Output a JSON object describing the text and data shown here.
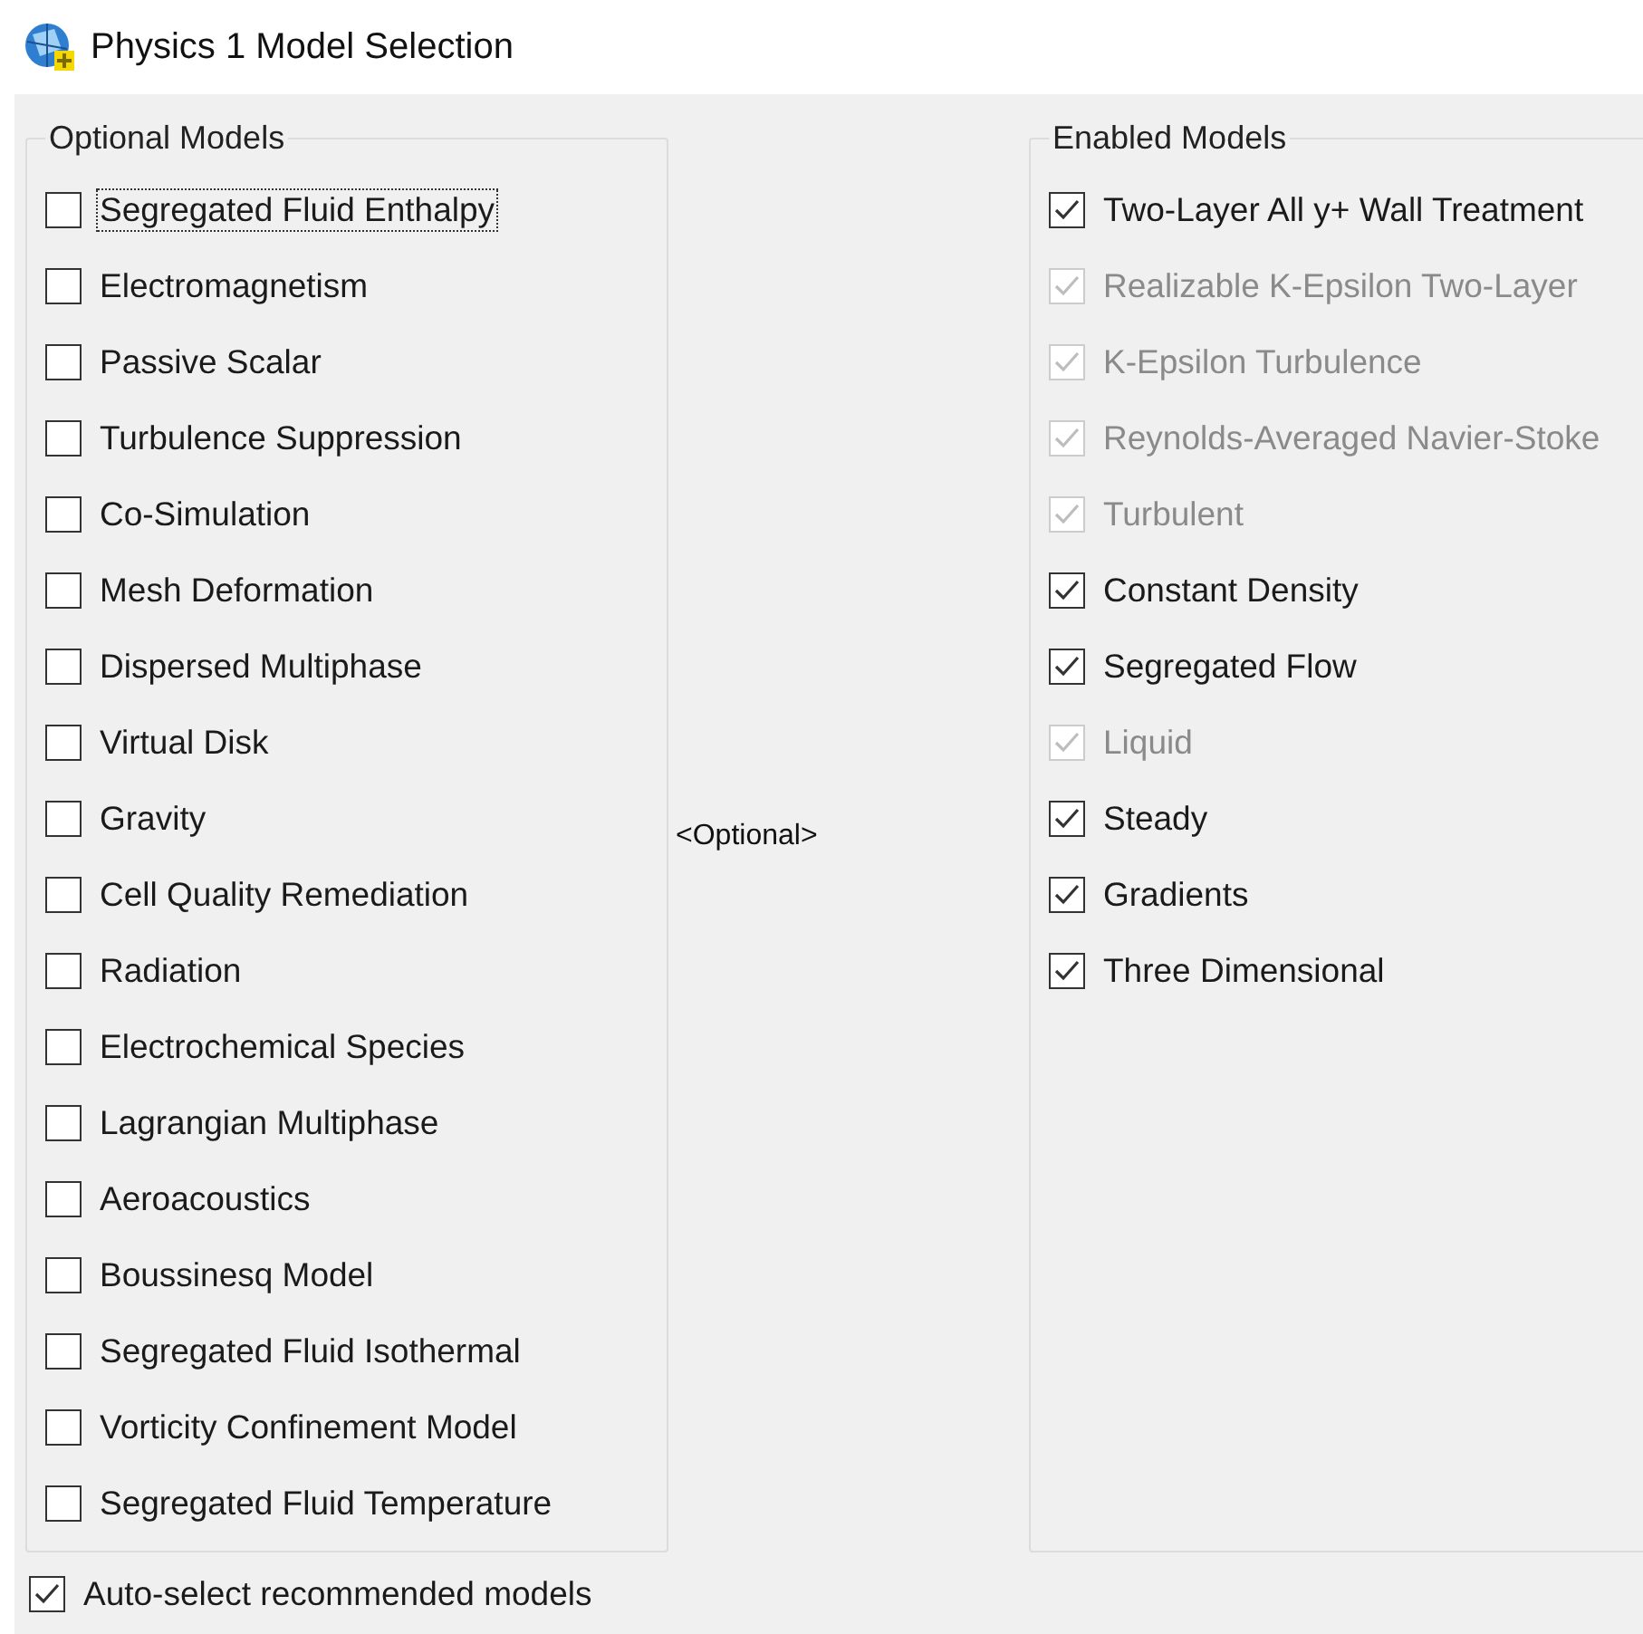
{
  "window": {
    "title": "Physics 1 Model Selection"
  },
  "optional_models": {
    "title": "Optional Models",
    "items": [
      {
        "label": "Segregated Fluid Enthalpy",
        "checked": false,
        "focused": true
      },
      {
        "label": "Electromagnetism",
        "checked": false,
        "focused": false
      },
      {
        "label": "Passive Scalar",
        "checked": false,
        "focused": false
      },
      {
        "label": "Turbulence Suppression",
        "checked": false,
        "focused": false
      },
      {
        "label": "Co-Simulation",
        "checked": false,
        "focused": false
      },
      {
        "label": "Mesh Deformation",
        "checked": false,
        "focused": false
      },
      {
        "label": "Dispersed Multiphase",
        "checked": false,
        "focused": false
      },
      {
        "label": "Virtual Disk",
        "checked": false,
        "focused": false
      },
      {
        "label": "Gravity",
        "checked": false,
        "focused": false
      },
      {
        "label": "Cell Quality Remediation",
        "checked": false,
        "focused": false
      },
      {
        "label": "Radiation",
        "checked": false,
        "focused": false
      },
      {
        "label": "Electrochemical Species",
        "checked": false,
        "focused": false
      },
      {
        "label": "Lagrangian Multiphase",
        "checked": false,
        "focused": false
      },
      {
        "label": "Aeroacoustics",
        "checked": false,
        "focused": false
      },
      {
        "label": "Boussinesq Model",
        "checked": false,
        "focused": false
      },
      {
        "label": "Segregated Fluid Isothermal",
        "checked": false,
        "focused": false
      },
      {
        "label": "Vorticity Confinement Model",
        "checked": false,
        "focused": false
      },
      {
        "label": "Segregated Fluid Temperature",
        "checked": false,
        "focused": false
      }
    ]
  },
  "description": "<Optional>",
  "enabled_models": {
    "title": "Enabled Models",
    "items": [
      {
        "label": "Two-Layer All y+ Wall Treatment",
        "checked": true,
        "disabled": false
      },
      {
        "label": "Realizable K-Epsilon Two-Layer",
        "checked": true,
        "disabled": true
      },
      {
        "label": "K-Epsilon Turbulence",
        "checked": true,
        "disabled": true
      },
      {
        "label": "Reynolds-Averaged Navier-Stoke",
        "checked": true,
        "disabled": true
      },
      {
        "label": "Turbulent",
        "checked": true,
        "disabled": true
      },
      {
        "label": "Constant Density",
        "checked": true,
        "disabled": false
      },
      {
        "label": "Segregated Flow",
        "checked": true,
        "disabled": false
      },
      {
        "label": "Liquid",
        "checked": true,
        "disabled": true
      },
      {
        "label": "Steady",
        "checked": true,
        "disabled": false
      },
      {
        "label": "Gradients",
        "checked": true,
        "disabled": false
      },
      {
        "label": "Three Dimensional",
        "checked": true,
        "disabled": false
      }
    ]
  },
  "auto_select": {
    "label": "Auto-select recommended models",
    "checked": true
  }
}
